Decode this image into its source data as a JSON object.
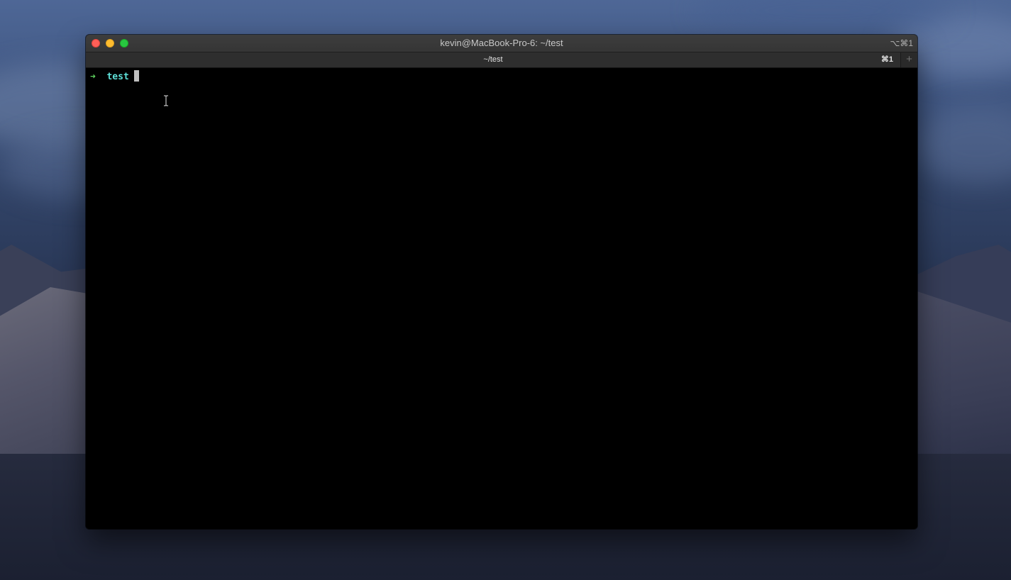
{
  "window": {
    "title": "kevin@MacBook-Pro-6: ~/test",
    "title_shortcut": "⌥⌘1"
  },
  "tabs": [
    {
      "label": "~/test",
      "shortcut": "⌘1"
    }
  ],
  "new_tab_symbol": "+",
  "terminal": {
    "prompt_symbol": "➜",
    "directory": "test",
    "input": ""
  },
  "colors": {
    "close": "#fe5f57",
    "minimize": "#febc2e",
    "maximize": "#28c840",
    "prompt_arrow": "#5fd35f",
    "prompt_dir": "#5ee0d8",
    "terminal_bg": "#000000"
  },
  "icons": {
    "cursor": "text-ibeam-cursor"
  }
}
